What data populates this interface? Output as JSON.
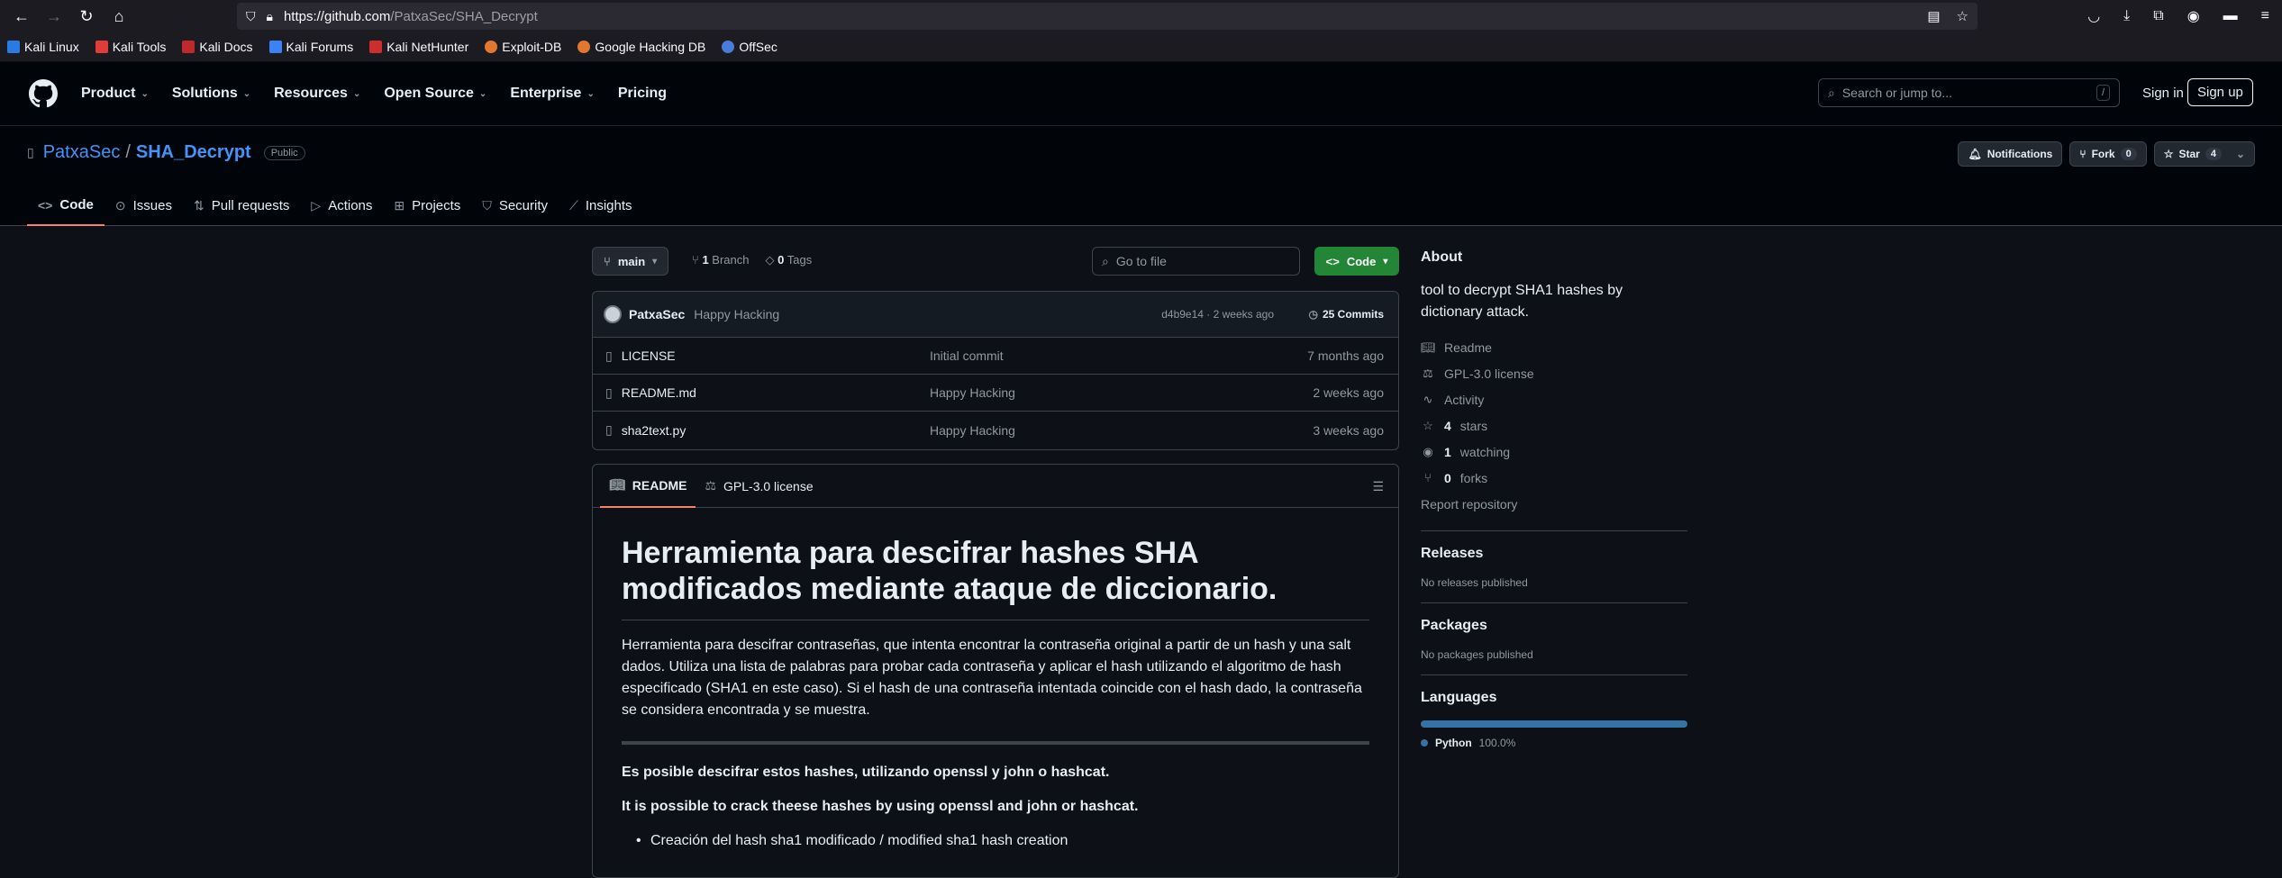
{
  "browser": {
    "url_host": "https://github.com",
    "url_path": "/PatxaSec/SHA_Decrypt",
    "bookmarks": [
      "Kali Linux",
      "Kali Tools",
      "Kali Docs",
      "Kali Forums",
      "Kali NetHunter",
      "Exploit-DB",
      "Google Hacking DB",
      "OffSec"
    ]
  },
  "header": {
    "nav": [
      "Product",
      "Solutions",
      "Resources",
      "Open Source",
      "Enterprise",
      "Pricing"
    ],
    "search_placeholder": "Search or jump to...",
    "search_kbd": "/",
    "signin": "Sign in",
    "signup": "Sign up"
  },
  "repo": {
    "owner": "PatxaSec",
    "sep": "/",
    "name": "SHA_Decrypt",
    "visibility": "Public",
    "notifications": "Notifications",
    "fork_label": "Fork",
    "fork_count": "0",
    "star_label": "Star",
    "star_count": "4",
    "tabs": [
      "Code",
      "Issues",
      "Pull requests",
      "Actions",
      "Projects",
      "Security",
      "Insights"
    ]
  },
  "code": {
    "branch": "main",
    "branch_count": "1",
    "branch_label": "Branch",
    "tag_count": "0",
    "tag_label": "Tags",
    "goto_placeholder": "Go to file",
    "code_button": "Code",
    "commit": {
      "author": "PatxaSec",
      "message": "Happy Hacking",
      "meta": "d4b9e14 · 2 weeks ago",
      "commits": "25 Commits"
    },
    "files": [
      {
        "name": "LICENSE",
        "commit": "Initial commit",
        "date": "7 months ago"
      },
      {
        "name": "README.md",
        "commit": "Happy Hacking",
        "date": "2 weeks ago"
      },
      {
        "name": "sha2text.py",
        "commit": "Happy Hacking",
        "date": "3 weeks ago"
      }
    ]
  },
  "readme": {
    "tab_readme": "README",
    "tab_license": "GPL-3.0 license",
    "title": "Herramienta para descifrar hashes SHA modificados mediante ataque de diccionario.",
    "paragraph": "Herramienta para descifrar contraseñas, que intenta encontrar la contraseña original a partir de un hash y una salt dados. Utiliza una lista de palabras para probar cada contraseña y aplicar el hash utilizando el algoritmo de hash especificado (SHA1 en este caso). Si el hash de una contraseña intentada coincide con el hash dado, la contraseña se considera encontrada y se muestra.",
    "bold1": "Es posible descifrar estos hashes, utilizando openssl y john o hashcat.",
    "bold2": "It is possible to crack theese hashes by using openssl and john or hashcat.",
    "li1": "Creación del hash sha1 modificado / modified sha1 hash creation"
  },
  "about": {
    "title": "About",
    "description": "tool to decrypt SHA1 hashes by dictionary attack.",
    "readme": "Readme",
    "license": "GPL-3.0 license",
    "activity": "Activity",
    "stars_n": "4",
    "stars": "stars",
    "watching_n": "1",
    "watching": "watching",
    "forks_n": "0",
    "forks": "forks",
    "report": "Report repository"
  },
  "releases": {
    "title": "Releases",
    "empty": "No releases published"
  },
  "packages": {
    "title": "Packages",
    "empty": "No packages published"
  },
  "languages": {
    "title": "Languages",
    "name": "Python",
    "percent": "100.0%",
    "color": "#3572a5"
  }
}
